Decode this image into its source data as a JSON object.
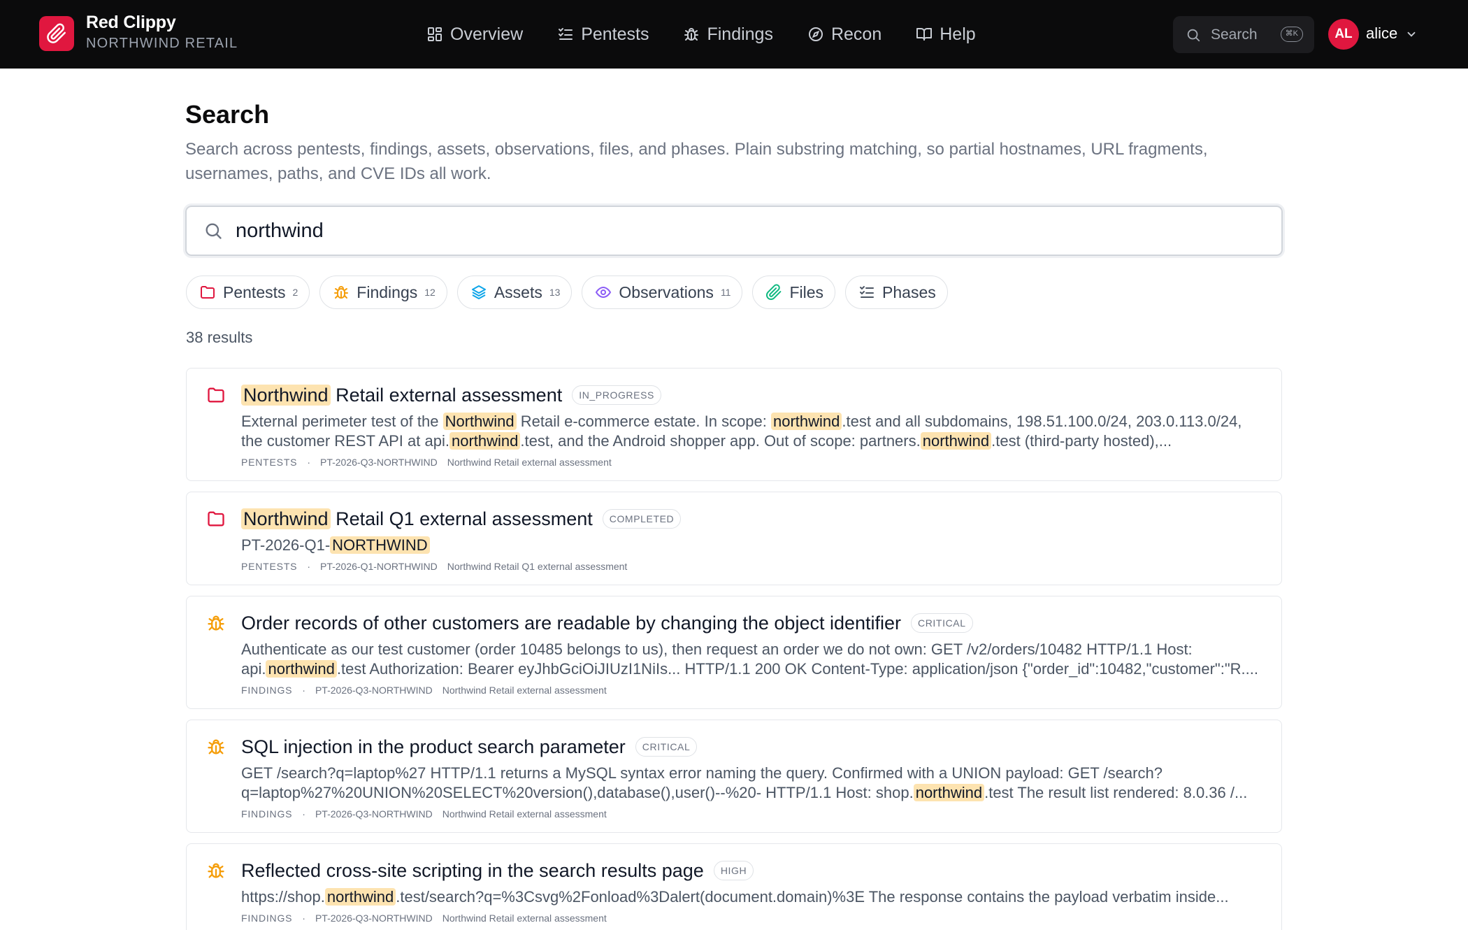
{
  "brand": {
    "name": "Red Clippy",
    "org": "NORTHWIND RETAIL",
    "accent": "#e0173f"
  },
  "nav": {
    "items": [
      {
        "label": "Overview",
        "icon": "grid-icon"
      },
      {
        "label": "Pentests",
        "icon": "checklist-icon"
      },
      {
        "label": "Findings",
        "icon": "bug-icon"
      },
      {
        "label": "Recon",
        "icon": "compass-icon"
      },
      {
        "label": "Help",
        "icon": "book-icon"
      }
    ],
    "search_label": "Search",
    "search_shortcut": "⌘K",
    "user": {
      "initials": "AL",
      "name": "alice"
    }
  },
  "page": {
    "title": "Search",
    "description": "Search across pentests, findings, assets, observations, files, and phases. Plain substring matching, so partial hostnames, URL fragments, usernames, paths, and CVE IDs all work.",
    "query": "northwind",
    "result_count": "38 results"
  },
  "filters": [
    {
      "label": "Pentests",
      "count": "2",
      "icon": "folder-icon",
      "color": "#e0173f"
    },
    {
      "label": "Findings",
      "count": "12",
      "icon": "bug-icon",
      "color": "#f59e0b"
    },
    {
      "label": "Assets",
      "count": "13",
      "icon": "layers-icon",
      "color": "#0ea5e9"
    },
    {
      "label": "Observations",
      "count": "11",
      "icon": "eye-icon",
      "color": "#8b5cf6"
    },
    {
      "label": "Files",
      "count": "",
      "icon": "paperclip-icon",
      "color": "#10b981"
    },
    {
      "label": "Phases",
      "count": "",
      "icon": "checklist-icon",
      "color": "#4b5563"
    }
  ],
  "results": [
    {
      "type": "pentest",
      "title": [
        {
          "t": "Northwind",
          "hl": true
        },
        {
          "t": " Retail external assessment"
        }
      ],
      "badge": "IN_PROGRESS",
      "snippet": [
        {
          "t": "External perimeter test of the "
        },
        {
          "t": "Northwind",
          "hl": true
        },
        {
          "t": " Retail e-commerce estate. In scope: "
        },
        {
          "t": "northwind",
          "hl": true
        },
        {
          "t": ".test and all subdomains, 198.51.100.0/24, 203.0.113.0/24, the customer REST API at api."
        },
        {
          "t": "northwind",
          "hl": true
        },
        {
          "t": ".test, and the Android shopper app. Out of scope: partners."
        },
        {
          "t": "northwind",
          "hl": true
        },
        {
          "t": ".test (third-party hosted),..."
        }
      ],
      "category": "PENTESTS",
      "code": "PT-2026-Q3-NORTHWIND",
      "parent": "Northwind Retail external assessment"
    },
    {
      "type": "pentest",
      "title": [
        {
          "t": "Northwind",
          "hl": true
        },
        {
          "t": " Retail Q1 external assessment"
        }
      ],
      "badge": "COMPLETED",
      "snippet": [
        {
          "t": "PT-2026-Q1-"
        },
        {
          "t": "NORTHWIND",
          "hl": true
        }
      ],
      "category": "PENTESTS",
      "code": "PT-2026-Q1-NORTHWIND",
      "parent": "Northwind Retail Q1 external assessment"
    },
    {
      "type": "finding",
      "title": [
        {
          "t": "Order records of other customers are readable by changing the object identifier"
        }
      ],
      "badge": "CRITICAL",
      "snippet": [
        {
          "t": "Authenticate as our test customer (order 10485 belongs to us), then request an order we do not own: GET /v2/orders/10482 HTTP/1.1 Host: api."
        },
        {
          "t": "northwind",
          "hl": true
        },
        {
          "t": ".test Authorization: Bearer eyJhbGciOiJIUzI1NiIs... HTTP/1.1 200 OK Content-Type: application/json {\"order_id\":10482,\"customer\":\"R...."
        }
      ],
      "category": "FINDINGS",
      "code": "PT-2026-Q3-NORTHWIND",
      "parent": "Northwind Retail external assessment"
    },
    {
      "type": "finding",
      "title": [
        {
          "t": "SQL injection in the product search parameter"
        }
      ],
      "badge": "CRITICAL",
      "snippet": [
        {
          "t": "GET /search?q=laptop%27 HTTP/1.1 returns a MySQL syntax error naming the query. Confirmed with a UNION payload: GET /search? q=laptop%27%20UNION%20SELECT%20version(),database(),user()--%20- HTTP/1.1 Host: shop."
        },
        {
          "t": "northwind",
          "hl": true
        },
        {
          "t": ".test The result list rendered: 8.0.36 /..."
        }
      ],
      "category": "FINDINGS",
      "code": "PT-2026-Q3-NORTHWIND",
      "parent": "Northwind Retail external assessment"
    },
    {
      "type": "finding",
      "title": [
        {
          "t": "Reflected cross-site scripting in the search results page"
        }
      ],
      "badge": "HIGH",
      "snippet": [
        {
          "t": "https://shop."
        },
        {
          "t": "northwind",
          "hl": true
        },
        {
          "t": ".test/search?q=%3Csvg%2Fonload%3Dalert(document.domain)%3E The response contains the payload verbatim inside..."
        }
      ],
      "category": "FINDINGS",
      "code": "PT-2026-Q3-NORTHWIND",
      "parent": "Northwind Retail external assessment"
    }
  ]
}
